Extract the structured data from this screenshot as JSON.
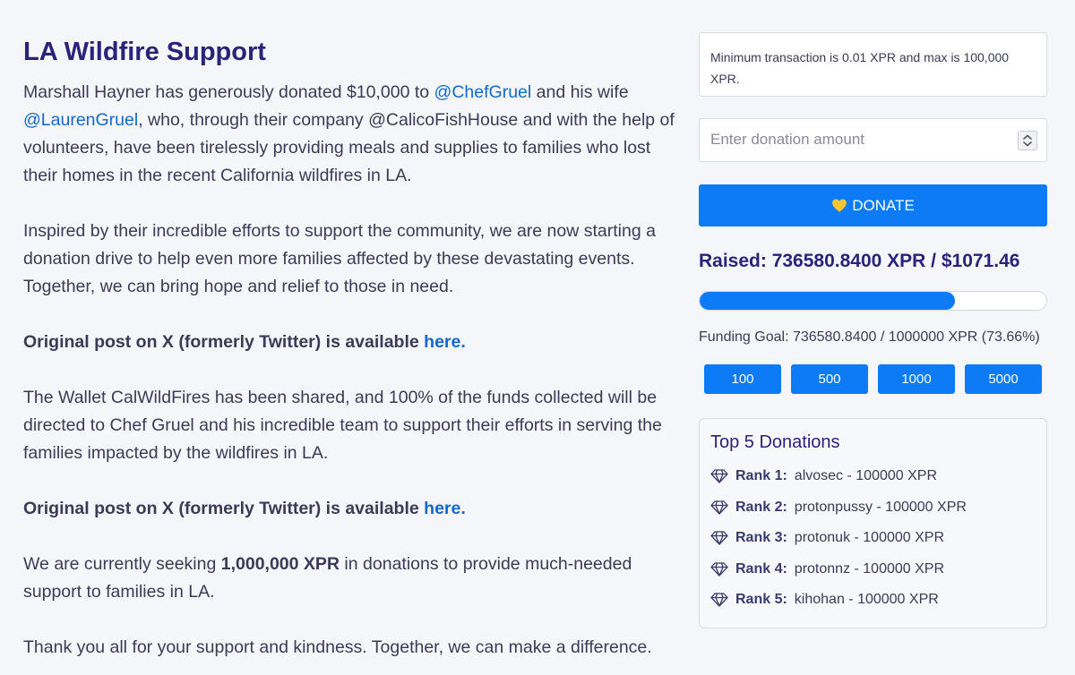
{
  "article": {
    "title": "LA Wildfire Support",
    "p1_a": "Marshall Hayner has generously donated $10,000 to ",
    "p1_link1": "@ChefGruel",
    "p1_b": " and his wife ",
    "p1_link2": "@LaurenGruel",
    "p1_c": ", who, through their company @CalicoFishHouse and with the help of volunteers, have been tirelessly providing meals and supplies to families who lost their homes in the recent California wildfires in LA.",
    "p2": "Inspired by their incredible efforts to support the community, we are now starting a donation drive to help even more families affected by these devastating events. Together, we can bring hope and relief to those in need.",
    "original_post_text": "Original post on X (formerly Twitter) is available ",
    "original_post_link": "here.",
    "p3": "The Wallet CalWildFires has been shared, and 100% of the funds collected will be directed to Chef Gruel and his incredible team to support their efforts in serving the families impacted by the wildfires in LA.",
    "p4_a": "We are currently seeking ",
    "p4_bold": "1,000,000 XPR",
    "p4_b": " in donations to provide much-needed support to families in LA.",
    "p5": "Thank you all for your support and kindness. Together, we can make a difference."
  },
  "donation": {
    "notice": "Minimum transaction is 0.01 XPR and max is 100,000 XPR.",
    "amount_placeholder": "Enter donation amount",
    "amount_value": "",
    "donate_label": "DONATE",
    "raised_text": "Raised: 736580.8400 XPR / $1071.46",
    "progress_fraction": 0.7366,
    "goal_text": "Funding Goal: 736580.8400 / 1000000 XPR (73.66%)",
    "quick_amounts": [
      "100",
      "500",
      "1000",
      "5000"
    ],
    "accent_color": "#0d7bf5"
  },
  "top_donations": {
    "title": "Top 5 Donations",
    "rows": [
      {
        "rank": "Rank 1:",
        "detail": "alvosec - 100000 XPR"
      },
      {
        "rank": "Rank 2:",
        "detail": "protonpussy - 100000 XPR"
      },
      {
        "rank": "Rank 3:",
        "detail": "protonuk - 100000 XPR"
      },
      {
        "rank": "Rank 4:",
        "detail": "protonnz - 100000 XPR"
      },
      {
        "rank": "Rank 5:",
        "detail": "kihohan - 100000 XPR"
      }
    ]
  },
  "icons": {
    "donate_button_icon": "yellow-heart-icon",
    "rank_icon": "diamond-icon",
    "stepper_icon": "number-stepper-icon"
  }
}
